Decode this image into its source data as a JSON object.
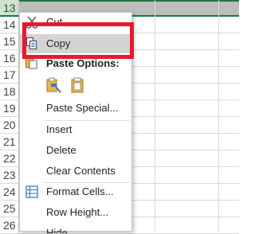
{
  "rows": [
    "13",
    "14",
    "15",
    "16",
    "17",
    "18",
    "19",
    "20",
    "21",
    "22",
    "23",
    "24",
    "25",
    "26"
  ],
  "menu": {
    "cut": "Cut",
    "copy": "Copy",
    "paste_options_header": "Paste Options:",
    "paste_special": "Paste Special...",
    "insert": "Insert",
    "delete": "Delete",
    "clear_contents": "Clear Contents",
    "format_cells": "Format Cells...",
    "row_height": "Row Height...",
    "hide": "Hide"
  },
  "colors": {
    "accent": "#217346",
    "highlight_box": "#e8192c",
    "hover": "#d4d4d4"
  },
  "icons": {
    "cut": "scissors-icon",
    "copy": "copy-icon",
    "paste_options": "paste-icon",
    "paste_formatting": "paste-brush-icon",
    "paste_values": "clipboard-icon",
    "format_cells": "format-cells-icon"
  }
}
